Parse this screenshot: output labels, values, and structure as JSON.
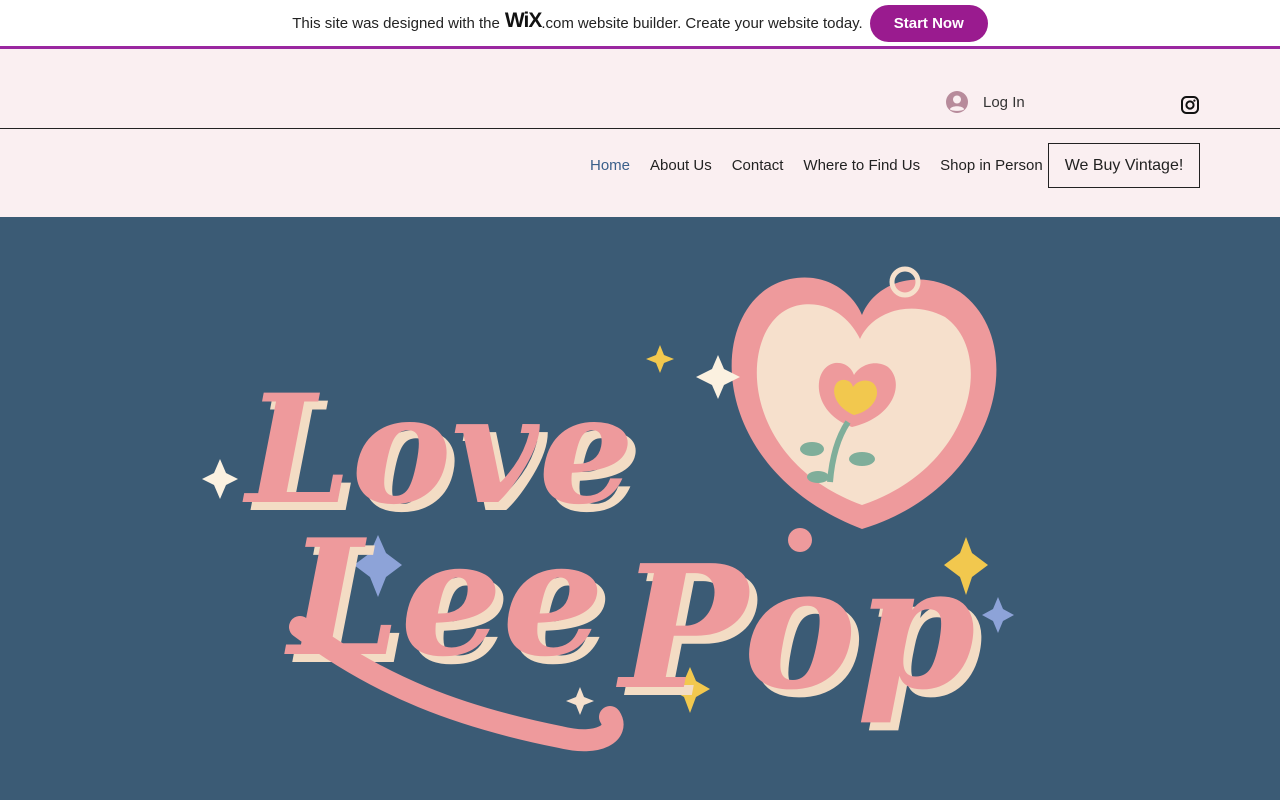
{
  "banner": {
    "text_before": "This site was designed with the",
    "wix_logo": "WiX",
    "wix_suffix": ".com",
    "text_after": "website builder. Create your website today.",
    "cta_label": "Start Now",
    "accent_color": "#9a1b8f"
  },
  "header": {
    "login_label": "Log In",
    "login_icon": "user-avatar-icon",
    "social_icon": "instagram-icon",
    "background_color": "#faeff1"
  },
  "nav": {
    "items": [
      {
        "label": "Home",
        "active": true
      },
      {
        "label": "About Us",
        "active": false
      },
      {
        "label": "Contact",
        "active": false
      },
      {
        "label": "Where to Find Us",
        "active": false
      },
      {
        "label": "Shop in Person",
        "active": false
      }
    ],
    "cta_label": "We Buy Vintage!"
  },
  "hero": {
    "background_color": "#3b5b75",
    "logo": {
      "line1": "Love",
      "line2": "Lee",
      "line3": "Pop",
      "primary_color": "#ee9a9c",
      "shadow_color": "#f3dcc4"
    }
  }
}
